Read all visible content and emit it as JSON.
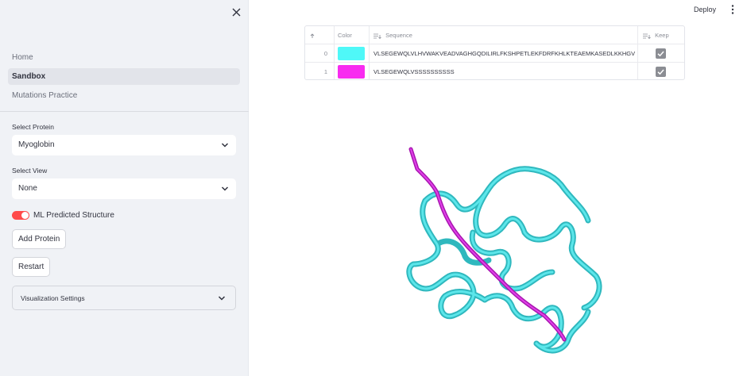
{
  "sidebar": {
    "nav": [
      {
        "label": "Home",
        "active": false
      },
      {
        "label": "Sandbox",
        "active": true
      },
      {
        "label": "Mutations Practice",
        "active": false
      }
    ],
    "protein_select": {
      "label": "Select Protein",
      "value": "Myoglobin"
    },
    "view_select": {
      "label": "Select View",
      "value": "None"
    },
    "toggle": {
      "label": "ML Predicted Structure",
      "on": true
    },
    "add_protein_label": "Add Protein",
    "restart_label": "Restart",
    "expander_label": "Visualization Settings"
  },
  "header": {
    "deploy_label": "Deploy"
  },
  "table": {
    "columns": [
      "",
      "Color",
      "Sequence",
      "Keep"
    ],
    "rows": [
      {
        "index": "0",
        "color": "#4ff8f8",
        "sequence": "VLSEGEWQLVLHVWAKVEADVAGHGQDILIRLFKSHPETLEKFDRFKHLKTEAEMKASEDLKKHGV",
        "keep": true
      },
      {
        "index": "1",
        "color": "#f82bf0",
        "sequence": "VLSEGEWQLVSSSSSSSSSS",
        "keep": true
      }
    ]
  },
  "colors": {
    "accent": "#ff4b4b",
    "sidebar_bg": "#f0f2f6",
    "cyan_chain": "#3fd0d6",
    "magenta_chain": "#b01ab8"
  },
  "icons": [
    "close-icon",
    "chevron-down-icon",
    "kebab-menu-icon",
    "sort-up-icon",
    "text-column-icon",
    "checkbox-checked-icon"
  ]
}
